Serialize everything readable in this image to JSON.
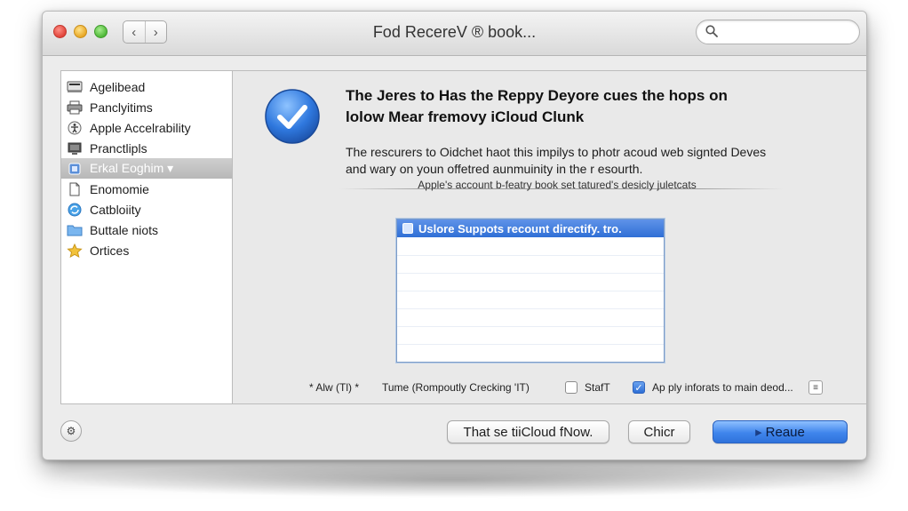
{
  "window": {
    "title": "Fod RecereV ® book...",
    "back_glyph": "‹",
    "forward_glyph": "›",
    "search": {
      "placeholder": ""
    }
  },
  "sidebar": {
    "items": [
      {
        "label": "Agelibead",
        "icon": "drive-icon",
        "selected": false
      },
      {
        "label": "Panclyitims",
        "icon": "printer-icon",
        "selected": false
      },
      {
        "label": "Apple Accelrability",
        "icon": "accessibility-icon",
        "selected": false
      },
      {
        "label": "Pranctlipls",
        "icon": "display-icon",
        "selected": false
      },
      {
        "label": "Erkal Eoghim ▾",
        "icon": "app-icon",
        "selected": true
      },
      {
        "label": "Enomomie",
        "icon": "document-icon",
        "selected": false
      },
      {
        "label": "Catbloiity",
        "icon": "sync-icon",
        "selected": false
      },
      {
        "label": "Buttale niots",
        "icon": "folder-icon",
        "selected": false
      },
      {
        "label": "Ortices",
        "icon": "star-icon",
        "selected": false
      }
    ]
  },
  "main": {
    "heading_line1": "The Jeres to Has the Reppy Deyore cues the hops on",
    "heading_line2": "lolow Mear fremovy iCloud Clunk",
    "body_line1": "The rescurers to Oidchet haot this impilys to photr acoud web signted Deves",
    "body_line2": "and wary on youn offetred aunmuinity in the r esourth.",
    "caption": "Apple's account b-featry book set tatured's desicly juletcats",
    "list": {
      "selected_row": "Uslore Suppots recount directify. tro."
    },
    "options": {
      "alw_label": "* Alw (Tl) *",
      "tune_label": "Tume (Rompoutly Crecking 'IT)",
      "staft_label": "StafT",
      "staft_checked": false,
      "apply_label": "Ap ply inforats to main deod...",
      "apply_checked": true,
      "more_glyph": "≡"
    }
  },
  "footer": {
    "gear_glyph": "⚙",
    "btn_left": "That se tiiCloud fNow.",
    "btn_mid": "Chicr",
    "btn_primary": "Reaue",
    "primary_glyph": "▸"
  },
  "colors": {
    "accent": "#2f6fd6",
    "sidebar_selection": "#bdbdbd",
    "window_bg": "#ececec"
  }
}
